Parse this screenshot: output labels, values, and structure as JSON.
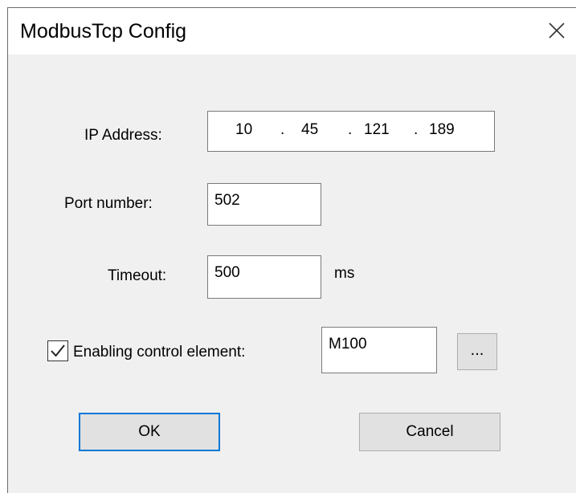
{
  "window": {
    "title": "ModbusTcp Config"
  },
  "ip": {
    "label": "IP Address:",
    "octets": [
      "10",
      "45",
      "121",
      "189"
    ],
    "separator": "."
  },
  "port": {
    "label": "Port number:",
    "value": "502"
  },
  "timeout": {
    "label": "Timeout:",
    "value": "500",
    "unit": "ms"
  },
  "enable": {
    "label": "Enabling control element:",
    "checked": true,
    "value": "M100",
    "browse_label": "..."
  },
  "buttons": {
    "ok": "OK",
    "cancel": "Cancel"
  },
  "icons": {
    "close": "close-icon",
    "checkmark": "checkmark-icon"
  },
  "colors": {
    "accent": "#0078d7",
    "dialog_bg": "#f0f0f0",
    "button_bg": "#e1e1e1"
  }
}
